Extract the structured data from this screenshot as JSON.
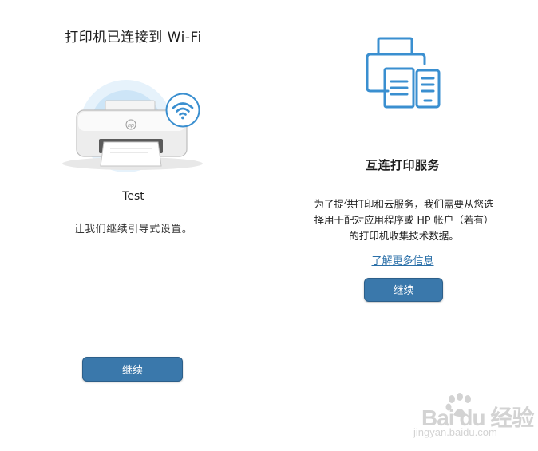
{
  "left_panel": {
    "title": "打印机已连接到 Wi-Fi",
    "device_name": "Test",
    "guide_text": "让我们继续引导式设置。",
    "continue_label": "继续",
    "logo_text": "hp"
  },
  "right_panel": {
    "title": "互连打印服务",
    "description_lines": [
      "为了提供打印和云服务，我们需要从您选",
      "择用于配对应用程序或 HP 帐户（若有）",
      "的打印机收集技术数据。"
    ],
    "learn_more_link": "了解更多信息",
    "continue_label": "继续"
  },
  "watermark": {
    "main_text": "Bai du 经验",
    "sub_text": "jingyan.baidu.com"
  },
  "colors": {
    "primary_button": "#3a78ab",
    "link": "#2a6fa8",
    "icon_blue": "#3a8fd0",
    "wifi_halo": "#cde5f7"
  },
  "icons": {
    "printer_illustration": "printer-wifi-illustration",
    "wifi_badge": "wifi-icon",
    "connected_devices": "printer-phone-icon"
  }
}
